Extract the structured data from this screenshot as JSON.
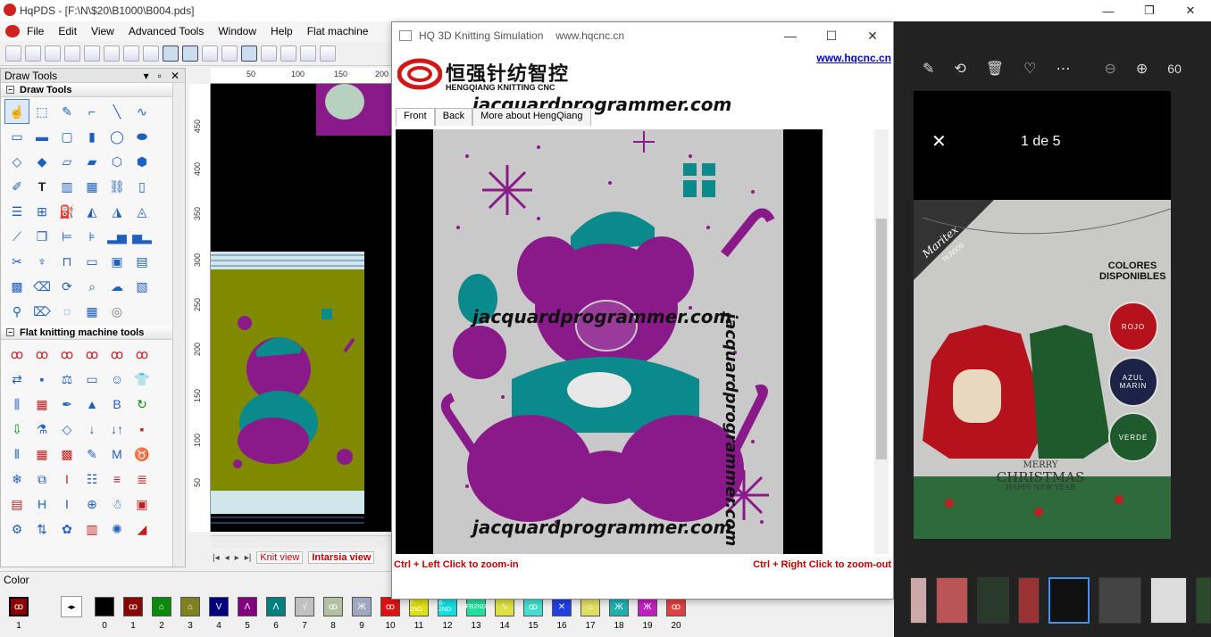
{
  "app": {
    "title": "HqPDS - [F:\\N\\$20\\B1000\\B004.pds]",
    "window_controls": [
      "—",
      "❐",
      "✕"
    ]
  },
  "menu": [
    "File",
    "Edit",
    "View",
    "Advanced Tools",
    "Window",
    "Help",
    "Flat machine"
  ],
  "draw_tools": {
    "panel_title": "Draw Tools",
    "panel_controls": [
      "▾",
      "▫",
      "✕"
    ],
    "section1": "Draw Tools",
    "section2": "Flat knitting machine tools"
  },
  "ruler": {
    "top": [
      "50",
      "100",
      "150",
      "200"
    ],
    "left": [
      "450",
      "400",
      "350",
      "300",
      "250",
      "200",
      "150",
      "100",
      "50"
    ]
  },
  "view_tabs": {
    "nav": [
      "|◂",
      "◂",
      "▸",
      "▸|"
    ],
    "knit": "Knit view",
    "intarsia": "Intarsia view"
  },
  "color_bar": {
    "title": "Color",
    "current_index": "1",
    "swatches": [
      {
        "n": "0",
        "color": "#000000",
        "label": ""
      },
      {
        "n": "1",
        "color": "#8b0000",
        "label": "ꝏ"
      },
      {
        "n": "2",
        "color": "#0a8a0a",
        "label": "⌂"
      },
      {
        "n": "3",
        "color": "#808020",
        "label": "⌂"
      },
      {
        "n": "4",
        "color": "#000080",
        "label": "V"
      },
      {
        "n": "5",
        "color": "#800080",
        "label": "Λ"
      },
      {
        "n": "6",
        "color": "#008080",
        "label": "Λ"
      },
      {
        "n": "7",
        "color": "#c0c0c0",
        "label": "√"
      },
      {
        "n": "8",
        "color": "#b0c0a0",
        "label": "ꝏ"
      },
      {
        "n": "9",
        "color": "#a0a8c0",
        "label": "Ж"
      },
      {
        "n": "10",
        "color": "#e01010",
        "label": "ꝏ"
      },
      {
        "n": "11",
        "color": "#e0e010",
        "label": "F-2ND"
      },
      {
        "n": "12",
        "color": "#10e0e0",
        "label": "B-2ND"
      },
      {
        "n": "13",
        "color": "#20e0a0",
        "label": "FB2ND"
      },
      {
        "n": "14",
        "color": "#e0e040",
        "label": "∿"
      },
      {
        "n": "15",
        "color": "#40e0d0",
        "label": "ꝏ"
      },
      {
        "n": "16",
        "color": "#2040e0",
        "label": "✕"
      },
      {
        "n": "17",
        "color": "#e0e060",
        "label": "⌂"
      },
      {
        "n": "18",
        "color": "#20b0b0",
        "label": "Ж"
      },
      {
        "n": "19",
        "color": "#c020c0",
        "label": "Ж"
      },
      {
        "n": "20",
        "color": "#e04040",
        "label": "ꝏ"
      }
    ]
  },
  "sim": {
    "title": "HQ 3D Knitting Simulation",
    "title_url": "www.hqcnc.cn",
    "link": "www.hqcnc.cn",
    "logo_cn": "恒强针纺智控",
    "logo_en": "HENGQIANG KNITTING CNC",
    "watermark": "jacquardprogrammer.com",
    "tabs": [
      "Front",
      "Back",
      "More about HengQiang"
    ],
    "hint_left": "Ctrl + Left Click to zoom-in",
    "hint_right": "Ctrl + Right Click to zoom-out",
    "window_controls": [
      "—",
      "☐",
      "✕"
    ]
  },
  "viewer": {
    "zoom": "60",
    "counter": "1 de 5",
    "card": {
      "brand": "Maritex",
      "brand_sub": "TEJIDOS",
      "colors_title": "COLORES DISPONIBLES",
      "colors": [
        {
          "label": "ROJO",
          "hex": "#b5121b"
        },
        {
          "label": "AZUL MARIN",
          "hex": "#1c2346"
        },
        {
          "label": "VERDE",
          "hex": "#1e5a2c"
        }
      ],
      "greeting1": "MERRY",
      "greeting2": "CHRISTMAS",
      "greeting3": "HAPPY NEW YEAR"
    }
  }
}
